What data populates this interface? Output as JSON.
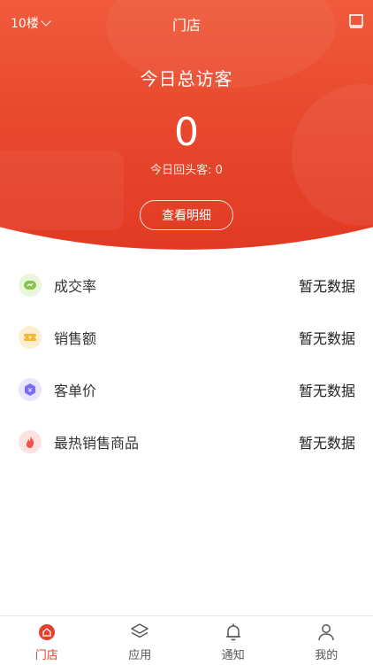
{
  "header": {
    "floor": "10楼",
    "title": "门店"
  },
  "hero": {
    "caption": "今日总访客",
    "visitor_count": "0",
    "returning_label": "今日回头客:",
    "returning_value": "0",
    "detail_button": "查看明细"
  },
  "stats": [
    {
      "label": "成交率",
      "value": "暂无数据",
      "icon": "conversion-icon",
      "color": "#8bc34a"
    },
    {
      "label": "销售额",
      "value": "暂无数据",
      "icon": "ticket-icon",
      "color": "#f5b82e"
    },
    {
      "label": "客单价",
      "value": "暂无数据",
      "icon": "yuan-hexagon-icon",
      "color": "#7b6cf6"
    },
    {
      "label": "最热销售商品",
      "value": "暂无数据",
      "icon": "flame-icon",
      "color": "#f0524a"
    }
  ],
  "tabs": [
    {
      "label": "门店",
      "icon": "store-icon",
      "active": true
    },
    {
      "label": "应用",
      "icon": "layers-icon",
      "active": false
    },
    {
      "label": "通知",
      "icon": "bell-icon",
      "active": false
    },
    {
      "label": "我的",
      "icon": "user-icon",
      "active": false
    }
  ],
  "colors": {
    "accent": "#e4402a",
    "hero_top": "#f05a3a",
    "hero_bottom": "#e23a24"
  }
}
